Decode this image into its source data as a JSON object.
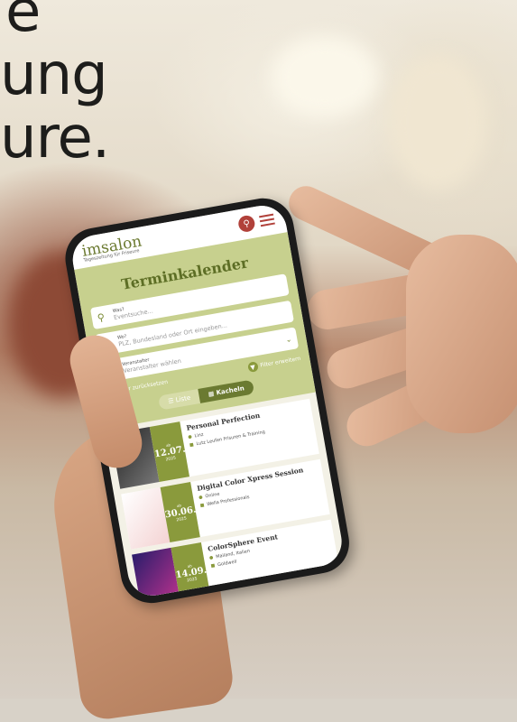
{
  "headline": [
    "e",
    "ung",
    "ure."
  ],
  "app": {
    "logo": "imsalon",
    "logo_tagline": "Tageszeitung für Friseure",
    "page_title": "Terminkalender",
    "fields": [
      {
        "label": "Was?",
        "placeholder": "Eventsuche...",
        "icon": "search-icon"
      },
      {
        "label": "Wo?",
        "placeholder": "PLZ, Bundesland oder Ort eingeben...",
        "icon": "location-pin-icon"
      },
      {
        "label": "Veranstalter",
        "placeholder": "Veranstalter wählen",
        "icon": "building-icon"
      }
    ],
    "filter_reset": "Filter zurücksetzen",
    "filter_extend": "Filter erweitern",
    "view_list": "Liste",
    "view_tiles": "Kacheln",
    "events": [
      {
        "title": "Personal Perfection",
        "date_prefix": "ab",
        "date": "12.07.",
        "year": "2025",
        "location": "Linz",
        "organizer": "Lutz Leufen Frisuren & Training"
      },
      {
        "title": "Digital Color Xpress Session",
        "date_prefix": "ab",
        "date": "30.06.",
        "year": "2025",
        "location": "Online",
        "organizer": "Wella Professionals"
      },
      {
        "title": "ColorSphere Event",
        "date_prefix": "ab",
        "date": "14.09.",
        "year": "2025",
        "location": "Mailand, Italien",
        "organizer": "Goldwell"
      }
    ]
  },
  "colors": {
    "accent_green": "#8a9a3c",
    "accent_red": "#b1413a"
  }
}
